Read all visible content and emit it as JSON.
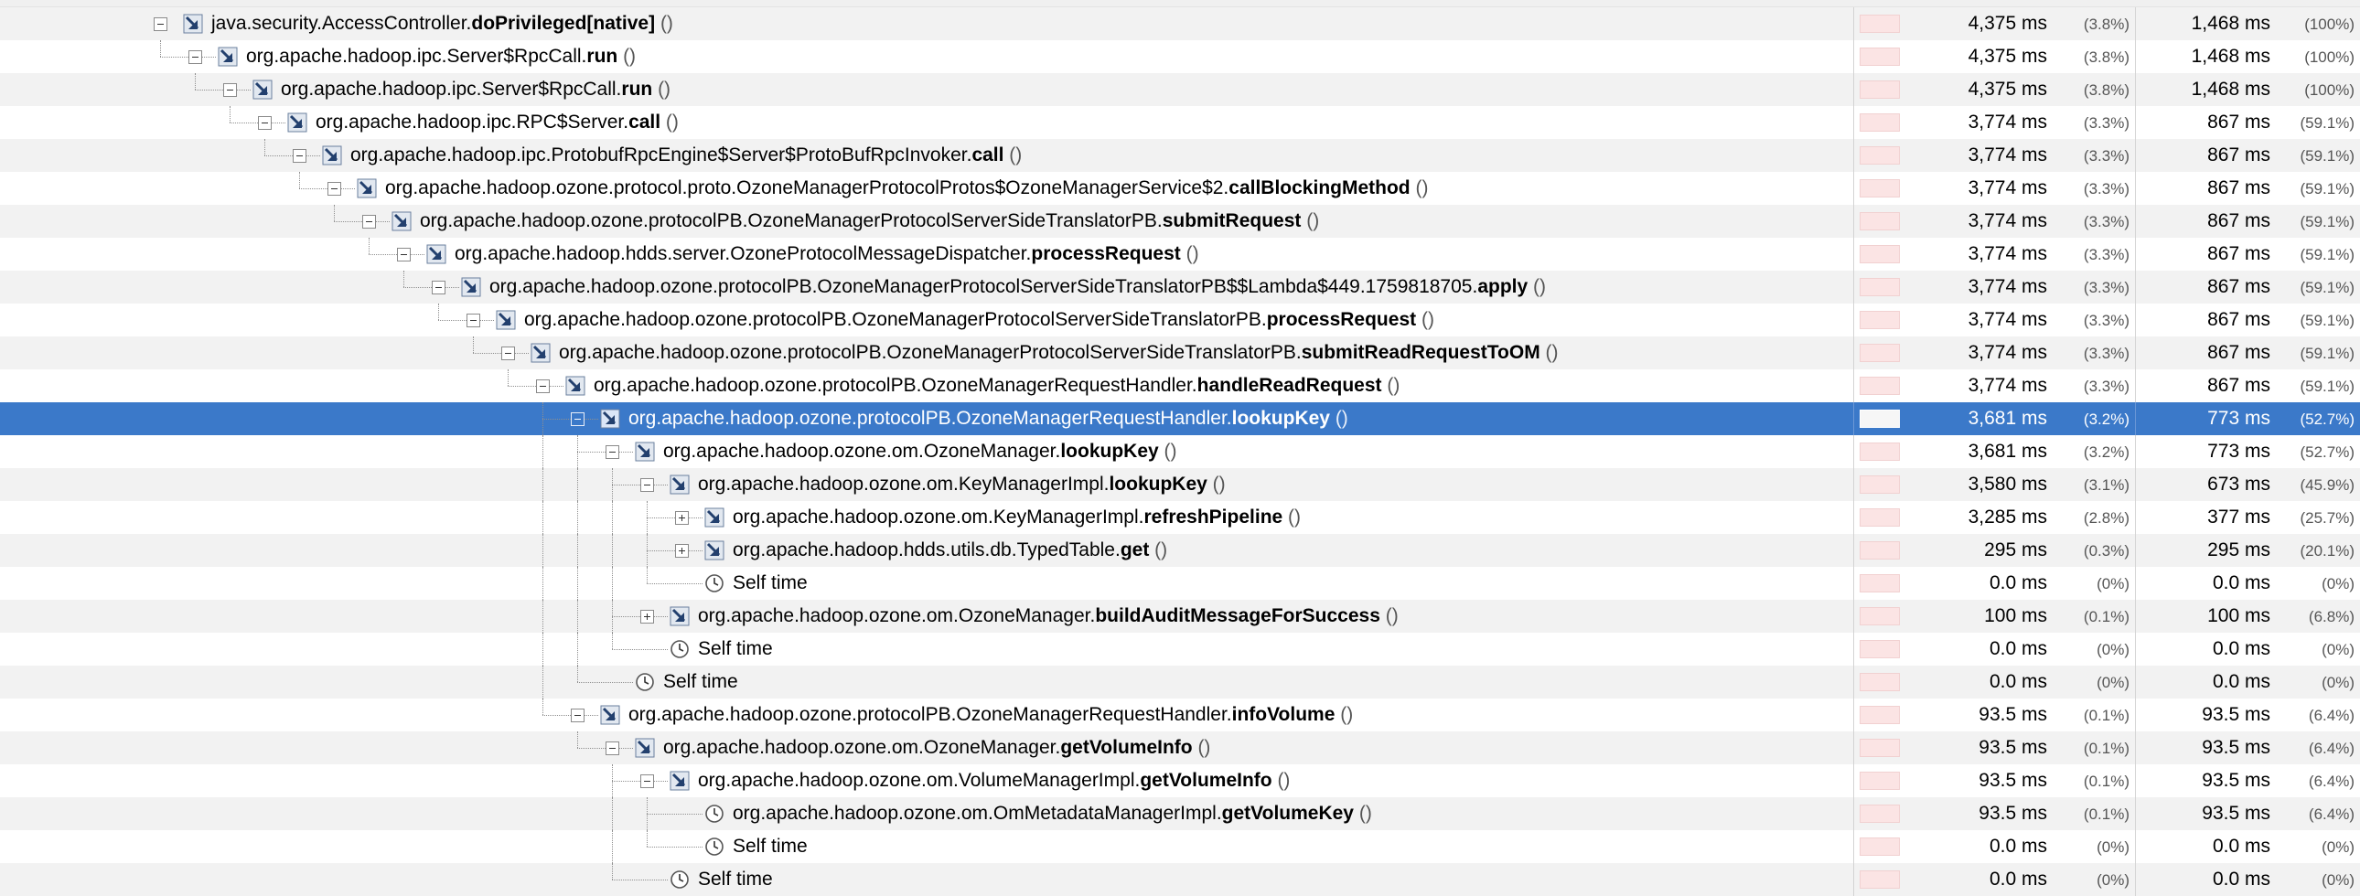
{
  "rows": [
    {
      "cls": "java.security.AccessController.",
      "m": "doPrivileged[native]",
      "p": " ()",
      "total": "4,375 ms",
      "total_pct": "(3.8%)",
      "self": "1,468 ms",
      "self_pct": "(100%)",
      "depth": 0,
      "type": "method",
      "expander": "open",
      "bar_fraction": 0.038
    },
    {
      "cls": "org.apache.hadoop.ipc.Server$RpcCall.",
      "m": "run",
      "p": " ()",
      "total": "4,375 ms",
      "total_pct": "(3.8%)",
      "self": "1,468 ms",
      "self_pct": "(100%)",
      "depth": 1,
      "type": "method",
      "expander": "open",
      "bar_fraction": 0.038
    },
    {
      "cls": "org.apache.hadoop.ipc.Server$RpcCall.",
      "m": "run",
      "p": " ()",
      "total": "4,375 ms",
      "total_pct": "(3.8%)",
      "self": "1,468 ms",
      "self_pct": "(100%)",
      "depth": 2,
      "type": "method",
      "expander": "open",
      "bar_fraction": 0.038
    },
    {
      "cls": "org.apache.hadoop.ipc.RPC$Server.",
      "m": "call",
      "p": " ()",
      "total": "3,774 ms",
      "total_pct": "(3.3%)",
      "self": "867 ms",
      "self_pct": "(59.1%)",
      "depth": 3,
      "type": "method",
      "expander": "open",
      "bar_fraction": 0.033
    },
    {
      "cls": "org.apache.hadoop.ipc.ProtobufRpcEngine$Server$ProtoBufRpcInvoker.",
      "m": "call",
      "p": " ()",
      "total": "3,774 ms",
      "total_pct": "(3.3%)",
      "self": "867 ms",
      "self_pct": "(59.1%)",
      "depth": 4,
      "type": "method",
      "expander": "open",
      "bar_fraction": 0.033
    },
    {
      "cls": "org.apache.hadoop.ozone.protocol.proto.OzoneManagerProtocolProtos$OzoneManagerService$2.",
      "m": "callBlockingMethod",
      "p": " ()",
      "total": "3,774 ms",
      "total_pct": "(3.3%)",
      "self": "867 ms",
      "self_pct": "(59.1%)",
      "depth": 5,
      "type": "method",
      "expander": "open",
      "bar_fraction": 0.033
    },
    {
      "cls": "org.apache.hadoop.ozone.protocolPB.OzoneManagerProtocolServerSideTranslatorPB.",
      "m": "submitRequest",
      "p": " ()",
      "total": "3,774 ms",
      "total_pct": "(3.3%)",
      "self": "867 ms",
      "self_pct": "(59.1%)",
      "depth": 6,
      "type": "method",
      "expander": "open",
      "bar_fraction": 0.033
    },
    {
      "cls": "org.apache.hadoop.hdds.server.OzoneProtocolMessageDispatcher.",
      "m": "processRequest",
      "p": " ()",
      "total": "3,774 ms",
      "total_pct": "(3.3%)",
      "self": "867 ms",
      "self_pct": "(59.1%)",
      "depth": 7,
      "type": "method",
      "expander": "open",
      "bar_fraction": 0.033
    },
    {
      "cls": "org.apache.hadoop.ozone.protocolPB.OzoneManagerProtocolServerSideTranslatorPB$$Lambda$449.1759818705.",
      "m": "apply",
      "p": " ()",
      "total": "3,774 ms",
      "total_pct": "(3.3%)",
      "self": "867 ms",
      "self_pct": "(59.1%)",
      "depth": 8,
      "type": "method",
      "expander": "open",
      "bar_fraction": 0.033
    },
    {
      "cls": "org.apache.hadoop.ozone.protocolPB.OzoneManagerProtocolServerSideTranslatorPB.",
      "m": "processRequest",
      "p": " ()",
      "total": "3,774 ms",
      "total_pct": "(3.3%)",
      "self": "867 ms",
      "self_pct": "(59.1%)",
      "depth": 9,
      "type": "method",
      "expander": "open",
      "bar_fraction": 0.033
    },
    {
      "cls": "org.apache.hadoop.ozone.protocolPB.OzoneManagerProtocolServerSideTranslatorPB.",
      "m": "submitReadRequestToOM",
      "p": " ()",
      "total": "3,774 ms",
      "total_pct": "(3.3%)",
      "self": "867 ms",
      "self_pct": "(59.1%)",
      "depth": 10,
      "type": "method",
      "expander": "open",
      "bar_fraction": 0.033
    },
    {
      "cls": "org.apache.hadoop.ozone.protocolPB.OzoneManagerRequestHandler.",
      "m": "handleReadRequest",
      "p": " ()",
      "total": "3,774 ms",
      "total_pct": "(3.3%)",
      "self": "867 ms",
      "self_pct": "(59.1%)",
      "depth": 11,
      "type": "method",
      "expander": "open",
      "bar_fraction": 0.033
    },
    {
      "cls": "org.apache.hadoop.ozone.protocolPB.OzoneManagerRequestHandler.",
      "m": "lookupKey",
      "p": " ()",
      "total": "3,681 ms",
      "total_pct": "(3.2%)",
      "self": "773 ms",
      "self_pct": "(52.7%)",
      "depth": 12,
      "type": "method",
      "expander": "open",
      "selected": true,
      "bar_fraction": 0.032
    },
    {
      "cls": "org.apache.hadoop.ozone.om.OzoneManager.",
      "m": "lookupKey",
      "p": " ()",
      "total": "3,681 ms",
      "total_pct": "(3.2%)",
      "self": "773 ms",
      "self_pct": "(52.7%)",
      "depth": 13,
      "type": "method",
      "expander": "open",
      "bar_fraction": 0.032
    },
    {
      "cls": "org.apache.hadoop.ozone.om.KeyManagerImpl.",
      "m": "lookupKey",
      "p": " ()",
      "total": "3,580 ms",
      "total_pct": "(3.1%)",
      "self": "673 ms",
      "self_pct": "(45.9%)",
      "depth": 14,
      "type": "method",
      "expander": "open",
      "bar_fraction": 0.031
    },
    {
      "cls": "org.apache.hadoop.ozone.om.KeyManagerImpl.",
      "m": "refreshPipeline",
      "p": " ()",
      "total": "3,285 ms",
      "total_pct": "(2.8%)",
      "self": "377 ms",
      "self_pct": "(25.7%)",
      "depth": 15,
      "type": "method",
      "expander": "closed",
      "bar_fraction": 0.028
    },
    {
      "cls": "org.apache.hadoop.hdds.utils.db.TypedTable.",
      "m": "get",
      "p": " ()",
      "total": "295 ms",
      "total_pct": "(0.3%)",
      "self": "295 ms",
      "self_pct": "(20.1%)",
      "depth": 15,
      "type": "method",
      "expander": "closed",
      "bar_fraction": 0.003
    },
    {
      "cls": "Self time",
      "m": "",
      "p": "",
      "total": "0.0 ms",
      "total_pct": "(0%)",
      "self": "0.0 ms",
      "self_pct": "(0%)",
      "depth": 15,
      "type": "self",
      "expander": "none",
      "bar_fraction": 0
    },
    {
      "cls": "org.apache.hadoop.ozone.om.OzoneManager.",
      "m": "buildAuditMessageForSuccess",
      "p": " ()",
      "total": "100 ms",
      "total_pct": "(0.1%)",
      "self": "100 ms",
      "self_pct": "(6.8%)",
      "depth": 14,
      "type": "method",
      "expander": "closed",
      "bar_fraction": 0.001
    },
    {
      "cls": "Self time",
      "m": "",
      "p": "",
      "total": "0.0 ms",
      "total_pct": "(0%)",
      "self": "0.0 ms",
      "self_pct": "(0%)",
      "depth": 14,
      "type": "self",
      "expander": "none",
      "bar_fraction": 0
    },
    {
      "cls": "Self time",
      "m": "",
      "p": "",
      "total": "0.0 ms",
      "total_pct": "(0%)",
      "self": "0.0 ms",
      "self_pct": "(0%)",
      "depth": 13,
      "type": "self",
      "expander": "none",
      "bar_fraction": 0
    },
    {
      "cls": "org.apache.hadoop.ozone.protocolPB.OzoneManagerRequestHandler.",
      "m": "infoVolume",
      "p": " ()",
      "total": "93.5 ms",
      "total_pct": "(0.1%)",
      "self": "93.5 ms",
      "self_pct": "(6.4%)",
      "depth": 12,
      "type": "method",
      "expander": "open",
      "bar_fraction": 0.001
    },
    {
      "cls": "org.apache.hadoop.ozone.om.OzoneManager.",
      "m": "getVolumeInfo",
      "p": " ()",
      "total": "93.5 ms",
      "total_pct": "(0.1%)",
      "self": "93.5 ms",
      "self_pct": "(6.4%)",
      "depth": 13,
      "type": "method",
      "expander": "open",
      "bar_fraction": 0.001
    },
    {
      "cls": "org.apache.hadoop.ozone.om.VolumeManagerImpl.",
      "m": "getVolumeInfo",
      "p": " ()",
      "total": "93.5 ms",
      "total_pct": "(0.1%)",
      "self": "93.5 ms",
      "self_pct": "(6.4%)",
      "depth": 14,
      "type": "method",
      "expander": "open",
      "bar_fraction": 0.001
    },
    {
      "cls": "org.apache.hadoop.ozone.om.OmMetadataManagerImpl.",
      "m": "getVolumeKey",
      "p": " ()",
      "total": "93.5 ms",
      "total_pct": "(0.1%)",
      "self": "93.5 ms",
      "self_pct": "(6.4%)",
      "depth": 15,
      "type": "self",
      "expander": "none",
      "bar_fraction": 0.001
    },
    {
      "cls": "Self time",
      "m": "",
      "p": "",
      "total": "0.0 ms",
      "total_pct": "(0%)",
      "self": "0.0 ms",
      "self_pct": "(0%)",
      "depth": 15,
      "type": "self",
      "expander": "none",
      "bar_fraction": 0
    },
    {
      "cls": "Self time",
      "m": "",
      "p": "",
      "total": "0.0 ms",
      "total_pct": "(0%)",
      "self": "0.0 ms",
      "self_pct": "(0%)",
      "depth": 14,
      "type": "self",
      "expander": "none",
      "bar_fraction": 0
    }
  ],
  "icons": {
    "method": "method-call-icon",
    "self": "clock-icon"
  },
  "colors": {
    "selection": "#3b79c9",
    "row_alt": "#f2f2f2",
    "bar": "#fbe4e4"
  }
}
